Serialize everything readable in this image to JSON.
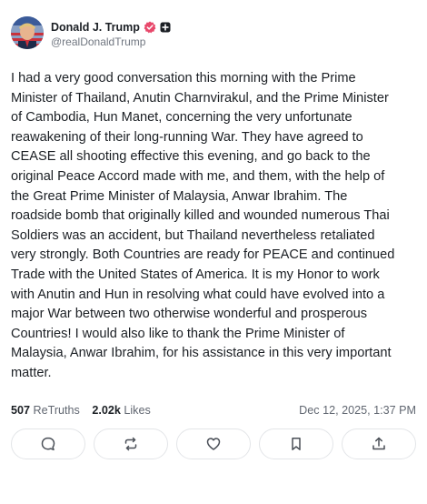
{
  "author": {
    "display_name": "Donald J. Trump",
    "handle": "@realDonaldTrump",
    "verified_icon": "verified-check-icon",
    "badge_icon": "truth-badge-icon"
  },
  "post": {
    "text": "I had a very good conversation this morning with the Prime\nMinister of Thailand, Anutin Charnvirakul, and the Prime Minister\nof Cambodia, Hun Manet, concerning the very unfortunate\nreawakening of their long-running War. They have agreed to\nCEASE all shooting effective this evening, and go back to the\noriginal Peace Accord made with me, and them, with the help of\nthe Great Prime Minister of Malaysia, Anwar Ibrahim. The\nroadside bomb that originally killed and wounded numerous Thai\nSoldiers was an accident, but Thailand nevertheless retaliated\nvery strongly. Both Countries are ready for PEACE and continued\nTrade with the United States of America. It is my Honor to work\nwith Anutin and Hun in resolving what could have evolved into a\nmajor War between two otherwise wonderful and prosperous\nCountries! I would also like to thank the Prime Minister of\nMalaysia, Anwar Ibrahim, for his assistance in this very important\nmatter.",
    "retruths_count": "507",
    "retruths_label": "ReTruths",
    "likes_count": "2.02k",
    "likes_label": "Likes",
    "timestamp": "Dec 12, 2025, 1:37 PM"
  },
  "actions": [
    {
      "icon": "comment-icon"
    },
    {
      "icon": "retruth-icon"
    },
    {
      "icon": "like-heart-icon"
    },
    {
      "icon": "bookmark-icon"
    },
    {
      "icon": "share-icon"
    }
  ],
  "colors": {
    "verified": "#e8486b",
    "text": "#1b1f24",
    "muted": "#616771",
    "border": "#e3e5e8",
    "icon": "#4a4f57"
  }
}
